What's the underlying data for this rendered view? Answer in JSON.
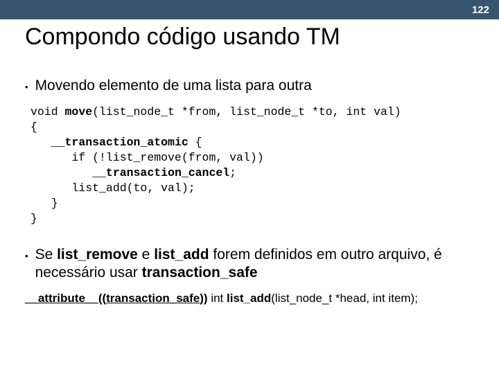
{
  "page_number": "122",
  "title": "Compondo código usando TM",
  "bullet1": "Movendo elemento de uma lista para outra",
  "code": {
    "l1a": "void ",
    "l1b": "move",
    "l1c": "(list_node_t *from, list_node_t *to, int val)",
    "l2": "{",
    "l3a": "   ",
    "l3b": "__transaction_atomic",
    "l3c": " {",
    "l4": "      if (!list_remove(from, val))",
    "l5a": "         ",
    "l5b": "__transaction_cancel",
    "l5c": ";",
    "l6": "      list_add(to, val);",
    "l7": "   }",
    "l8": "}"
  },
  "bullet2_a": "Se ",
  "bullet2_b": "list_remove",
  "bullet2_c": " e ",
  "bullet2_d": "list_add",
  "bullet2_e": " forem definidos em outro arquivo, é necessário usar ",
  "bullet2_f": "transaction_safe",
  "attr": {
    "a": "__attribute__((",
    "b": "transaction_safe",
    "c": "))",
    "d": "  int ",
    "e": "list_add",
    "f": "(list_node_t *head, int item);"
  }
}
